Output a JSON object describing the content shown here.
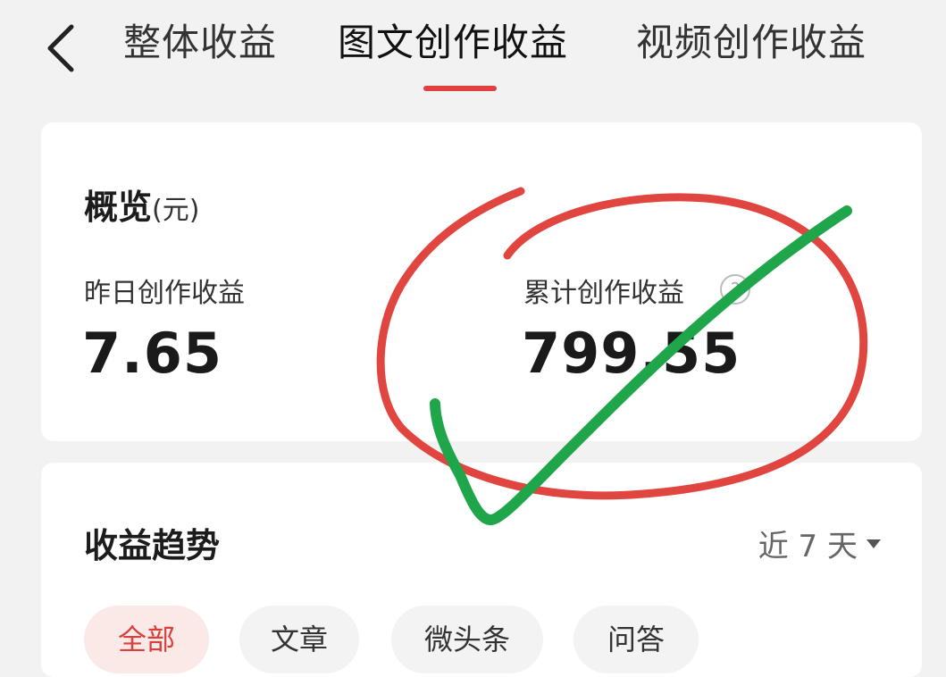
{
  "header": {
    "tabs": [
      {
        "label": "整体收益"
      },
      {
        "label": "图文创作收益"
      },
      {
        "label": "视频创作收益"
      }
    ],
    "active_tab": "图文创作收益",
    "accent_color": "#e0413e"
  },
  "overview": {
    "title": "概览",
    "unit": "(元)",
    "yesterday": {
      "label": "昨日创作收益",
      "value": "7.65"
    },
    "total": {
      "label": "累计创作收益",
      "value": "799.55",
      "help_icon": "question-circle-icon"
    }
  },
  "trend": {
    "title": "收益趋势",
    "range": "近 7 天",
    "filters": [
      "全部",
      "文章",
      "微头条",
      "问答"
    ],
    "active_filter": "全部"
  },
  "annotations": {
    "circle_color": "#e0453f",
    "check_color": "#1fa64a"
  }
}
